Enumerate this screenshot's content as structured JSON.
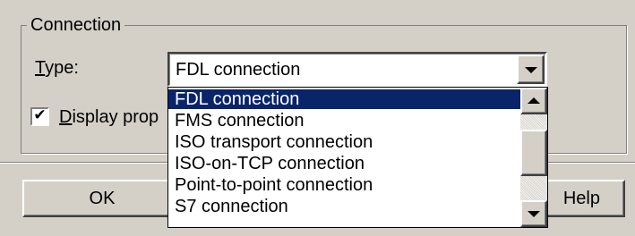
{
  "group": {
    "title": "Connection"
  },
  "type_field": {
    "label_accel": "T",
    "label_rest": "ype:",
    "value": "FDL connection"
  },
  "display_option": {
    "accel": "D",
    "label_rest": "isplay prop",
    "checked": true,
    "check_glyph": "✔"
  },
  "dropdown": {
    "items": [
      {
        "label": "FDL connection",
        "selected": true
      },
      {
        "label": "FMS connection",
        "selected": false
      },
      {
        "label": "ISO transport connection",
        "selected": false
      },
      {
        "label": "ISO-on-TCP connection",
        "selected": false
      },
      {
        "label": "Point-to-point connection",
        "selected": false
      },
      {
        "label": "S7 connection",
        "selected": false
      }
    ]
  },
  "buttons": {
    "ok": "OK",
    "help": "Help"
  },
  "colors": {
    "face": "#d4d0c8",
    "selection": "#0a246a",
    "selection_text": "#ffffff"
  },
  "icons": {
    "dropdown_arrow": "chevron-down-icon",
    "scroll_up": "arrow-up-icon",
    "scroll_down": "arrow-down-icon",
    "check": "checkmark-icon"
  }
}
